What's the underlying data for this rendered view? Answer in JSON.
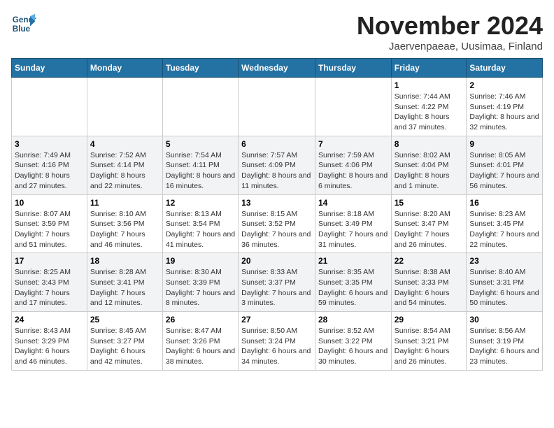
{
  "logo": {
    "line1": "General",
    "line2": "Blue"
  },
  "title": "November 2024",
  "location": "Jaervenpaeae, Uusimaa, Finland",
  "days_of_week": [
    "Sunday",
    "Monday",
    "Tuesday",
    "Wednesday",
    "Thursday",
    "Friday",
    "Saturday"
  ],
  "weeks": [
    [
      {
        "day": "",
        "info": ""
      },
      {
        "day": "",
        "info": ""
      },
      {
        "day": "",
        "info": ""
      },
      {
        "day": "",
        "info": ""
      },
      {
        "day": "",
        "info": ""
      },
      {
        "day": "1",
        "info": "Sunrise: 7:44 AM\nSunset: 4:22 PM\nDaylight: 8 hours and 37 minutes."
      },
      {
        "day": "2",
        "info": "Sunrise: 7:46 AM\nSunset: 4:19 PM\nDaylight: 8 hours and 32 minutes."
      }
    ],
    [
      {
        "day": "3",
        "info": "Sunrise: 7:49 AM\nSunset: 4:16 PM\nDaylight: 8 hours and 27 minutes."
      },
      {
        "day": "4",
        "info": "Sunrise: 7:52 AM\nSunset: 4:14 PM\nDaylight: 8 hours and 22 minutes."
      },
      {
        "day": "5",
        "info": "Sunrise: 7:54 AM\nSunset: 4:11 PM\nDaylight: 8 hours and 16 minutes."
      },
      {
        "day": "6",
        "info": "Sunrise: 7:57 AM\nSunset: 4:09 PM\nDaylight: 8 hours and 11 minutes."
      },
      {
        "day": "7",
        "info": "Sunrise: 7:59 AM\nSunset: 4:06 PM\nDaylight: 8 hours and 6 minutes."
      },
      {
        "day": "8",
        "info": "Sunrise: 8:02 AM\nSunset: 4:04 PM\nDaylight: 8 hours and 1 minute."
      },
      {
        "day": "9",
        "info": "Sunrise: 8:05 AM\nSunset: 4:01 PM\nDaylight: 7 hours and 56 minutes."
      }
    ],
    [
      {
        "day": "10",
        "info": "Sunrise: 8:07 AM\nSunset: 3:59 PM\nDaylight: 7 hours and 51 minutes."
      },
      {
        "day": "11",
        "info": "Sunrise: 8:10 AM\nSunset: 3:56 PM\nDaylight: 7 hours and 46 minutes."
      },
      {
        "day": "12",
        "info": "Sunrise: 8:13 AM\nSunset: 3:54 PM\nDaylight: 7 hours and 41 minutes."
      },
      {
        "day": "13",
        "info": "Sunrise: 8:15 AM\nSunset: 3:52 PM\nDaylight: 7 hours and 36 minutes."
      },
      {
        "day": "14",
        "info": "Sunrise: 8:18 AM\nSunset: 3:49 PM\nDaylight: 7 hours and 31 minutes."
      },
      {
        "day": "15",
        "info": "Sunrise: 8:20 AM\nSunset: 3:47 PM\nDaylight: 7 hours and 26 minutes."
      },
      {
        "day": "16",
        "info": "Sunrise: 8:23 AM\nSunset: 3:45 PM\nDaylight: 7 hours and 22 minutes."
      }
    ],
    [
      {
        "day": "17",
        "info": "Sunrise: 8:25 AM\nSunset: 3:43 PM\nDaylight: 7 hours and 17 minutes."
      },
      {
        "day": "18",
        "info": "Sunrise: 8:28 AM\nSunset: 3:41 PM\nDaylight: 7 hours and 12 minutes."
      },
      {
        "day": "19",
        "info": "Sunrise: 8:30 AM\nSunset: 3:39 PM\nDaylight: 7 hours and 8 minutes."
      },
      {
        "day": "20",
        "info": "Sunrise: 8:33 AM\nSunset: 3:37 PM\nDaylight: 7 hours and 3 minutes."
      },
      {
        "day": "21",
        "info": "Sunrise: 8:35 AM\nSunset: 3:35 PM\nDaylight: 6 hours and 59 minutes."
      },
      {
        "day": "22",
        "info": "Sunrise: 8:38 AM\nSunset: 3:33 PM\nDaylight: 6 hours and 54 minutes."
      },
      {
        "day": "23",
        "info": "Sunrise: 8:40 AM\nSunset: 3:31 PM\nDaylight: 6 hours and 50 minutes."
      }
    ],
    [
      {
        "day": "24",
        "info": "Sunrise: 8:43 AM\nSunset: 3:29 PM\nDaylight: 6 hours and 46 minutes."
      },
      {
        "day": "25",
        "info": "Sunrise: 8:45 AM\nSunset: 3:27 PM\nDaylight: 6 hours and 42 minutes."
      },
      {
        "day": "26",
        "info": "Sunrise: 8:47 AM\nSunset: 3:26 PM\nDaylight: 6 hours and 38 minutes."
      },
      {
        "day": "27",
        "info": "Sunrise: 8:50 AM\nSunset: 3:24 PM\nDaylight: 6 hours and 34 minutes."
      },
      {
        "day": "28",
        "info": "Sunrise: 8:52 AM\nSunset: 3:22 PM\nDaylight: 6 hours and 30 minutes."
      },
      {
        "day": "29",
        "info": "Sunrise: 8:54 AM\nSunset: 3:21 PM\nDaylight: 6 hours and 26 minutes."
      },
      {
        "day": "30",
        "info": "Sunrise: 8:56 AM\nSunset: 3:19 PM\nDaylight: 6 hours and 23 minutes."
      }
    ]
  ]
}
